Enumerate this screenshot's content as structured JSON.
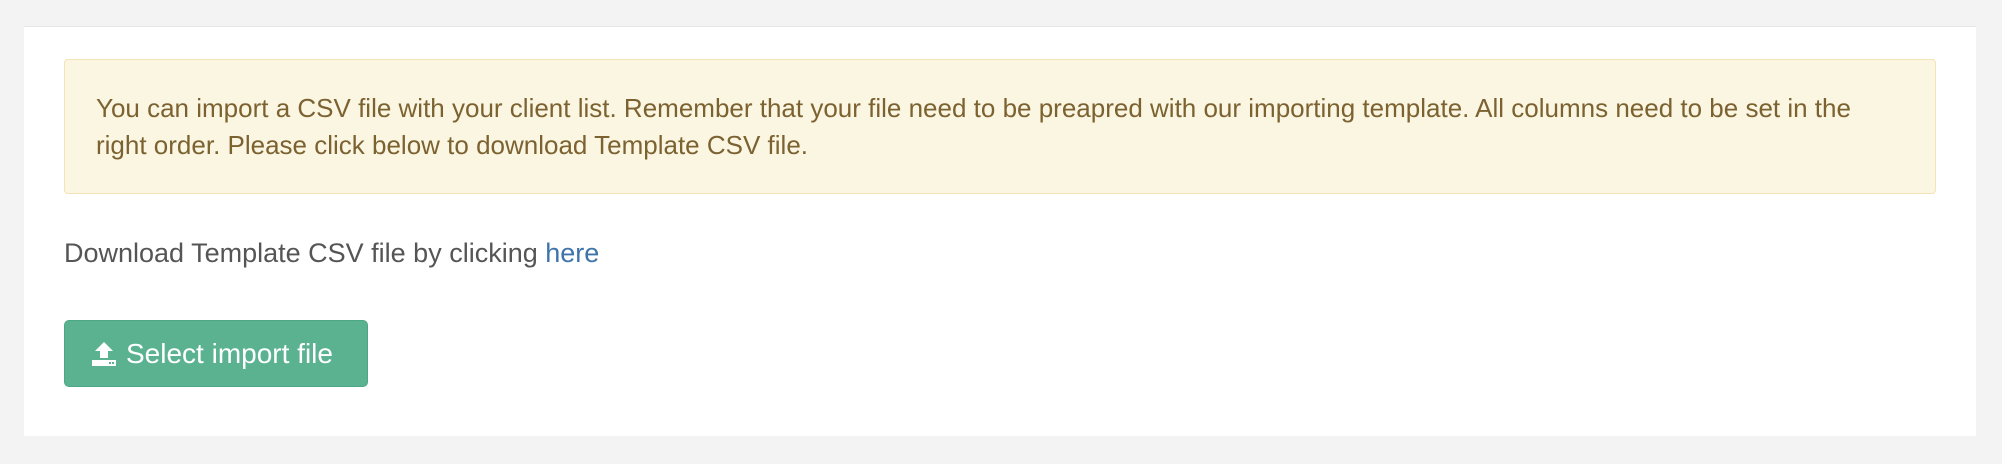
{
  "alert": {
    "message": "You can import a CSV file with your client list. Remember that your file need to be preapred with our importing template. All columns need to be set in the right order. Please click below to download Template CSV file."
  },
  "download": {
    "prefix": "Download Template CSV file by clicking ",
    "link_label": "here"
  },
  "import_button": {
    "label": "Select import file",
    "icon": "upload-icon"
  },
  "colors": {
    "alert_background": "#faf6e2",
    "alert_text": "#7c6231",
    "link": "#3f74aa",
    "button_background": "#5bb291"
  }
}
